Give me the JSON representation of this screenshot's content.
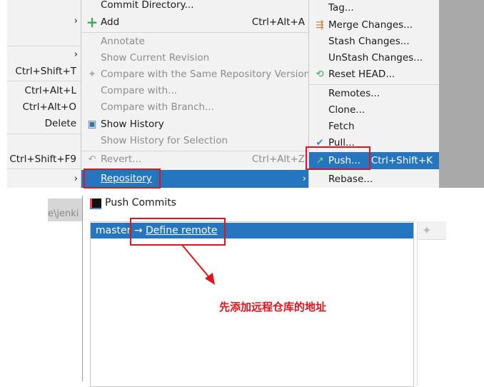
{
  "left_menu": {
    "shortcuts": [
      "Ctrl+Shift+T",
      "Ctrl+Alt+L",
      "Ctrl+Alt+O",
      "Delete",
      "Ctrl+Shift+F9"
    ],
    "submenu_arrow": "›"
  },
  "vcs_menu": {
    "items": [
      {
        "label": "Commit Directory...",
        "enabled": true
      },
      {
        "label": "Add",
        "shortcut": "Ctrl+Alt+A",
        "icon": "plus-icon",
        "enabled": true
      },
      {
        "label": "Annotate",
        "enabled": false
      },
      {
        "label": "Show Current Revision",
        "enabled": false
      },
      {
        "label": "Compare with the Same Repository Version",
        "icon": "compare-icon",
        "enabled": false
      },
      {
        "label": "Compare with...",
        "enabled": false
      },
      {
        "label": "Compare with Branch...",
        "enabled": false
      },
      {
        "label": "Show History",
        "icon": "history-icon",
        "enabled": true
      },
      {
        "label": "Show History for Selection",
        "enabled": false
      },
      {
        "label": "Revert...",
        "shortcut": "Ctrl+Alt+Z",
        "icon": "revert-icon",
        "enabled": false
      },
      {
        "label": "Repository",
        "submenu": true,
        "selected": true,
        "enabled": true
      }
    ]
  },
  "repo_menu": {
    "items": [
      {
        "label": "Tag..."
      },
      {
        "label": "Merge Changes...",
        "icon": "merge-icon"
      },
      {
        "label": "Stash Changes..."
      },
      {
        "label": "UnStash Changes..."
      },
      {
        "label": "Reset HEAD...",
        "icon": "reset-icon"
      },
      {
        "label": "Remotes..."
      },
      {
        "label": "Clone..."
      },
      {
        "label": "Fetch"
      },
      {
        "label": "Pull...",
        "icon": "pull-icon"
      },
      {
        "label": "Push...",
        "shortcut": "Ctrl+Shift+K",
        "icon": "push-icon",
        "selected": true
      },
      {
        "label": "Rebase..."
      }
    ]
  },
  "push_dialog": {
    "background_path": "e\\jenki",
    "title": "Push Commits",
    "branch": "master",
    "arrow": "→",
    "remote_link": "Define remote",
    "annotation": "先添加远程仓库的地址"
  },
  "colors": {
    "selection": "#2675bf",
    "annotation": "#e0141e",
    "menu_bg": "#f2f2f2"
  }
}
